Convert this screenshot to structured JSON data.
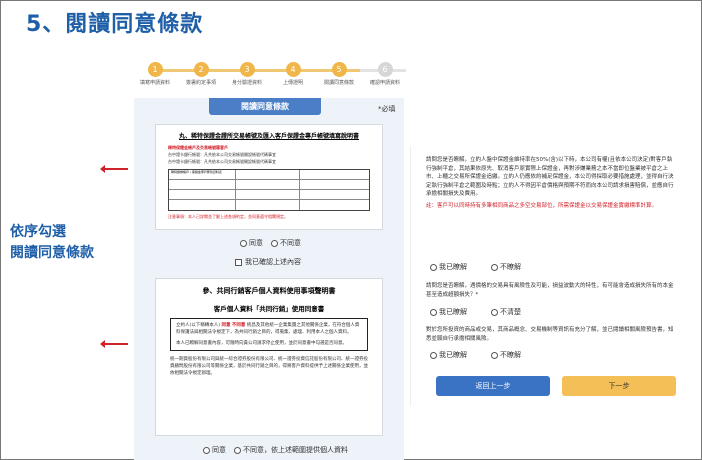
{
  "slide": {
    "title": "5、閱讀同意條款"
  },
  "annotation": {
    "line1": "依序勾選",
    "line2": "閱讀同意條款"
  },
  "stepper": {
    "steps": [
      {
        "num": "1",
        "label": "填寫申請資料"
      },
      {
        "num": "2",
        "label": "簽署約定事項"
      },
      {
        "num": "3",
        "label": "身分驗證資料"
      },
      {
        "num": "4",
        "label": "上傳證明"
      },
      {
        "num": "5",
        "label": "閱讀同意條款"
      },
      {
        "num": "6",
        "label": "確認申請資料"
      }
    ]
  },
  "panel": {
    "header": "閱讀同意條款",
    "required": "*必填"
  },
  "doc1": {
    "title": "丸、稀特保證金證所交易帳號及匯入客戶保證金專戶帳號填寫說明書",
    "red_line": "稀特保證金帳戶及交易帳號匯客戶",
    "lines": [
      "台中證卡銀行帳號：凡共依本公司交易帳號開設帳號代碼事宜",
      "台中證卡銀行帳號：凡共依本公司交易帳號開設帳號代碼事宜"
    ],
    "table_note": "稀特證券帳戶 / 保證金專戶匯款資料表",
    "footer": "注意事項：本人已詳閱並了解上述各項約定，並同意遵守相關規定。"
  },
  "doc1_options": {
    "agree": "同意",
    "disagree": "不同意"
  },
  "doc1_checkbox": "我已確認上述內容",
  "doc2": {
    "title": "參、共同行銷客戶個人資料使用事項聲明書",
    "subtitle": "客戶個人資料「共同行銷」使用同意書",
    "p1a": "立約人(以下稱轉本人)",
    "p1b": "同意",
    "p1c": "不同意",
    "p1d": "統昌及其他統一企業集團之其他關係企業，在符合個人資料保護法與相關法令規定下，為共同行銷之目的，得蒐集、處理、利用本人之個人資料。",
    "p2": "本人已瞭解同意書內容，可隨時向貴公司請求停止使用，並於同意書中勾選是否同意。",
    "body": "統一期貨股份有限公司與統一綜合證券股份有限公司、統一證券投資信託股份有限公司、統一證券投資顧問股份有限公司等關係企業，基於共同行銷之目的，得將客戶資料提供予上述關係企業使用，並依相關法令規定辦理。"
  },
  "doc2_options": {
    "agree": "同意",
    "disagree": "不同意，依上述範圍提供個人資料"
  },
  "right": {
    "q1": "請問您是否瞭解，立約人盤中保證金維持率在50%(含)以下時，本公司有權(且依本公司決定)對客戶執行強制平倉，其結果依原先、取消客戶原實際上保證金，再對涉嫌業務之本不當即位盤業被平倉之上市、上櫃之交易所保證金追繳。立約人仍應依約補足保證金，本公司得採取必要措施處理，並得自行決定執行強制平倉之範圍及時點；立約人不得因平倉價格與預期不符而向本公司請求損害賠償，並應自行承擔相關損失及費用。",
    "q1_note": "註：客戶可以同時持有多筆相同商品之多空交易部位，所需保證金以交易保證金實繳標準計算。",
    "q1_opt_a": "我已瞭解",
    "q1_opt_b": "不瞭解",
    "q2": "請問您是否瞭解，遇價格的交易具有風險性及可能，損益波動大的特性，有可能會造成損失所有的本金甚至造成超額損失？*",
    "q2_opt_a": "我已瞭解",
    "q2_opt_b": "不清楚",
    "q3": "對於您所投資的商品或交易，其商品概念、交易機制等資訊有充分了解，並已閱讀相關風險預告書，知悉並願自行承擔相關風險。",
    "q3_opt_a": "我已瞭解",
    "q3_opt_b": "不瞭解"
  },
  "buttons": {
    "back": "返回上一步",
    "next": "下一步"
  }
}
